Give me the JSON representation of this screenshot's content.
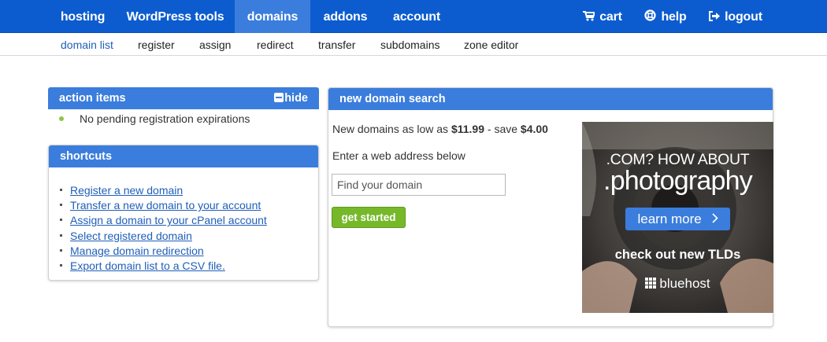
{
  "topnav": {
    "items": [
      {
        "label": "hosting"
      },
      {
        "label": "WordPress tools"
      },
      {
        "label": "domains"
      },
      {
        "label": "addons"
      },
      {
        "label": "account"
      }
    ],
    "cart": "cart",
    "help": "help",
    "logout": "logout"
  },
  "subnav": {
    "items": [
      {
        "label": "domain list"
      },
      {
        "label": "register"
      },
      {
        "label": "assign"
      },
      {
        "label": "redirect"
      },
      {
        "label": "transfer"
      },
      {
        "label": "subdomains"
      },
      {
        "label": "zone editor"
      }
    ]
  },
  "action_items": {
    "title": "action items",
    "hide_label": "hide",
    "message": "No pending registration expirations"
  },
  "shortcuts": {
    "title": "shortcuts",
    "links": [
      {
        "label": "Register a new domain"
      },
      {
        "label": "Transfer a new domain to your account"
      },
      {
        "label": "Assign a domain to your cPanel account"
      },
      {
        "label": "Select registered domain"
      },
      {
        "label": "Manage domain redirection"
      },
      {
        "label": "Export domain list to a CSV file."
      }
    ]
  },
  "domain_search": {
    "title": "new domain search",
    "promo_prefix": "New domains as low as",
    "price": "$11.99",
    "promo_middle": "- save",
    "savings": "$4.00",
    "instruction": "Enter a web address below",
    "placeholder": "Find your domain",
    "button_label": "get started"
  },
  "ad": {
    "line1": ".COM? HOW ABOUT",
    "line2": ".photography",
    "button": "learn more",
    "line3": "check out new TLDs",
    "brand": "bluehost"
  },
  "colors": {
    "nav_blue": "#0c5ccf",
    "header_blue": "#3b7ddc",
    "button_green": "#76b82a",
    "link_blue": "#1f5fb8"
  }
}
